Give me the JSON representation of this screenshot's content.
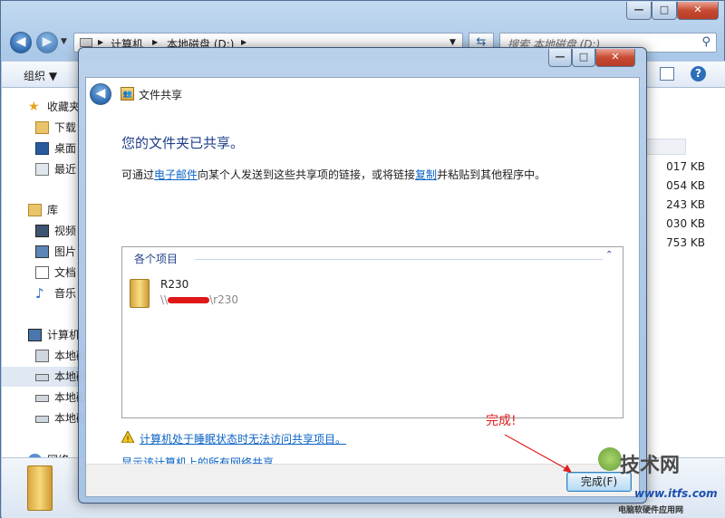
{
  "explorer": {
    "address": {
      "parts": [
        "计算机",
        "本地磁盘 (D:)"
      ]
    },
    "search_placeholder": "搜索 本地磁盘 (D:)",
    "organize_label": "组织 ▼",
    "nav": {
      "favorites": "收藏夹",
      "downloads": "下载",
      "desktop": "桌面",
      "recent": "最近",
      "libraries": "库",
      "videos": "视频",
      "pictures": "图片",
      "documents": "文档",
      "music": "音乐",
      "computer": "计算机",
      "disk1": "本地磁",
      "disk2": "本地磁",
      "disk3": "本地磁",
      "disk4": "本地磁",
      "network": "网络"
    },
    "sizes": [
      "017 KB",
      "054 KB",
      "243 KB",
      "030 KB",
      "753 KB"
    ]
  },
  "dialog": {
    "title": "文件共享",
    "heading": "您的文件夹已共享。",
    "desc_before": "可通过",
    "desc_link1": "电子邮件",
    "desc_mid": "向某个人发送到这些共享项的链接，或将链接",
    "desc_link2": "复制",
    "desc_after": "并粘贴到其他程序中。",
    "items_header": "各个项目",
    "item_name": "R230",
    "item_path_prefix": "\\\\",
    "item_path_suffix": "\\r230",
    "warning_link": "计算机处于睡眠状态时无法访问共享项目。",
    "show_all_link": "显示该计算机上的所有网络共享。",
    "finish_label": "完成(F)"
  },
  "annotation": {
    "text": "完成!",
    "color": "#e02020"
  },
  "watermark": {
    "main": "技术网",
    "sub": "电脑软硬件应用网",
    "url": "www.itfs.com"
  }
}
